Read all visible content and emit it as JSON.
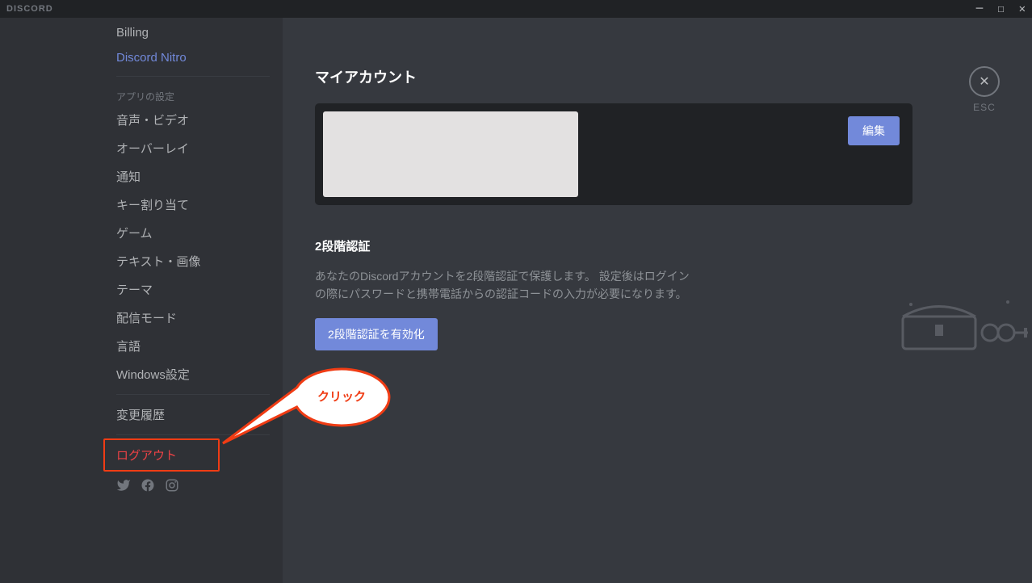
{
  "titlebar": {
    "app_name": "DISCORD"
  },
  "sidebar": {
    "items_top": [
      {
        "label": "Billing"
      },
      {
        "label": "Discord Nitro",
        "highlight": true
      }
    ],
    "app_settings_header": "アプリの設定",
    "items_settings": [
      {
        "label": "音声・ビデオ"
      },
      {
        "label": "オーバーレイ"
      },
      {
        "label": "通知"
      },
      {
        "label": "キー割り当て"
      },
      {
        "label": "ゲーム"
      },
      {
        "label": "テキスト・画像"
      },
      {
        "label": "テーマ"
      },
      {
        "label": "配信モード"
      },
      {
        "label": "言語"
      },
      {
        "label": "Windows設定"
      }
    ],
    "change_log": "変更履歴",
    "logout": "ログアウト"
  },
  "main": {
    "title": "マイアカウント",
    "edit_label": "編集",
    "twofa_title": "2段階認証",
    "twofa_description": "あなたのDiscordアカウントを2段階認証で保護します。 設定後はログインの際にパスワードと携帯電話からの認証コードの入力が必要になります。",
    "enable_2fa_label": "2段階認証を有効化",
    "close_label": "ESC"
  },
  "annotation": {
    "callout_text": "クリック"
  }
}
